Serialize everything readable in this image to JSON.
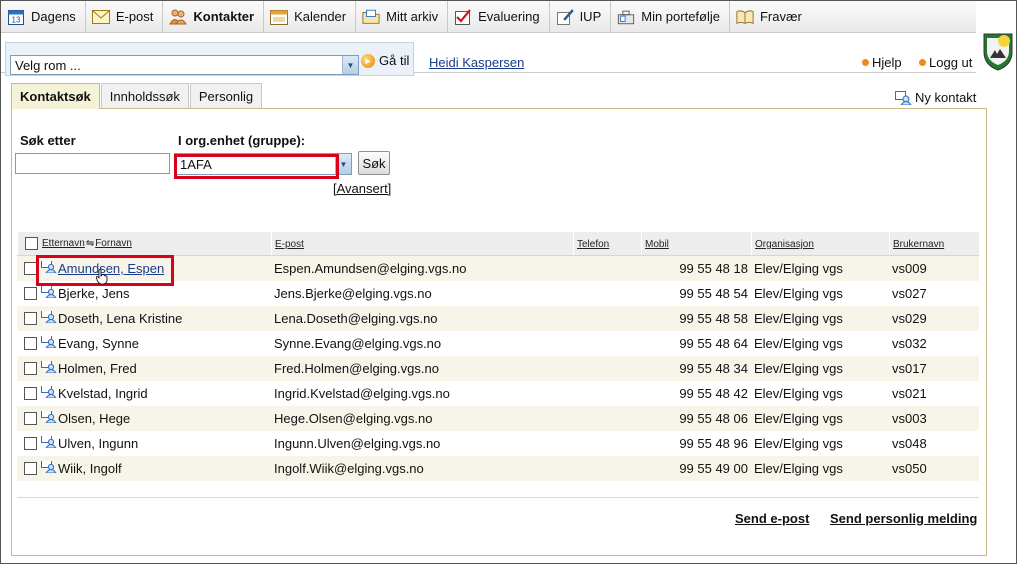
{
  "nav": {
    "items": [
      {
        "label": "Dagens",
        "icon": "calendar-day-icon",
        "active": false
      },
      {
        "label": "E-post",
        "icon": "envelope-icon",
        "active": false
      },
      {
        "label": "Kontakter",
        "icon": "contacts-icon",
        "active": true
      },
      {
        "label": "Kalender",
        "icon": "calendar-icon",
        "active": false
      },
      {
        "label": "Mitt arkiv",
        "icon": "folder-icon",
        "active": false
      },
      {
        "label": "Evaluering",
        "icon": "checkmark-icon",
        "active": false
      },
      {
        "label": "IUP",
        "icon": "edit-icon",
        "active": false
      },
      {
        "label": "Min portefølje",
        "icon": "portfolio-icon",
        "active": false
      },
      {
        "label": "Fravær",
        "icon": "book-icon",
        "active": false
      }
    ]
  },
  "toolbar": {
    "room_select": "Velg rom ...",
    "goto_label": "Gå til",
    "user_name": "Heidi Kaspersen",
    "help_label": "Hjelp",
    "logout_label": "Logg ut"
  },
  "tabs": [
    {
      "label": "Kontaktsøk",
      "active": true
    },
    {
      "label": "Innholdssøk",
      "active": false
    },
    {
      "label": "Personlig",
      "active": false
    }
  ],
  "new_contact_label": "Ny kontakt",
  "search": {
    "search_label": "Søk etter",
    "search_value": "",
    "org_label": "I org.enhet (gruppe):",
    "org_value": "1AFA",
    "search_button": "Søk",
    "advanced_link": "[Avansert]"
  },
  "table": {
    "headers": {
      "surname": "Etternavn",
      "firstname": "Fornavn",
      "email": "E-post",
      "phone": "Telefon",
      "mobile": "Mobil",
      "org": "Organisasjon",
      "username": "Brukernavn"
    },
    "rows": [
      {
        "name": "Amundsen, Espen",
        "email": "Espen.Amundsen@elging.vgs.no",
        "phone": "",
        "mobile": "99 55 48 18",
        "org": "Elev/Elging vgs",
        "user": "vs009",
        "link": true
      },
      {
        "name": "Bjerke, Jens",
        "email": "Jens.Bjerke@elging.vgs.no",
        "phone": "",
        "mobile": "99 55 48 54",
        "org": "Elev/Elging vgs",
        "user": "vs027",
        "link": false
      },
      {
        "name": "Doseth, Lena Kristine",
        "email": "Lena.Doseth@elging.vgs.no",
        "phone": "",
        "mobile": "99 55 48 58",
        "org": "Elev/Elging vgs",
        "user": "vs029",
        "link": false
      },
      {
        "name": "Evang, Synne",
        "email": "Synne.Evang@elging.vgs.no",
        "phone": "",
        "mobile": "99 55 48 64",
        "org": "Elev/Elging vgs",
        "user": "vs032",
        "link": false
      },
      {
        "name": "Holmen, Fred",
        "email": "Fred.Holmen@elging.vgs.no",
        "phone": "",
        "mobile": "99 55 48 34",
        "org": "Elev/Elging vgs",
        "user": "vs017",
        "link": false
      },
      {
        "name": "Kvelstad, Ingrid",
        "email": "Ingrid.Kvelstad@elging.vgs.no",
        "phone": "",
        "mobile": "99 55 48 42",
        "org": "Elev/Elging vgs",
        "user": "vs021",
        "link": false
      },
      {
        "name": "Olsen, Hege",
        "email": "Hege.Olsen@elging.vgs.no",
        "phone": "",
        "mobile": "99 55 48 06",
        "org": "Elev/Elging vgs",
        "user": "vs003",
        "link": false
      },
      {
        "name": "Ulven, Ingunn",
        "email": "Ingunn.Ulven@elging.vgs.no",
        "phone": "",
        "mobile": "99 55 48 96",
        "org": "Elev/Elging vgs",
        "user": "vs048",
        "link": false
      },
      {
        "name": "Wiik, Ingolf",
        "email": "Ingolf.Wiik@elging.vgs.no",
        "phone": "",
        "mobile": "99 55 49 00",
        "org": "Elev/Elging vgs",
        "user": "vs050",
        "link": false
      }
    ]
  },
  "footer": {
    "send_email": "Send e-post",
    "send_message": "Send personlig melding"
  },
  "colors": {
    "highlight": "#d9001b",
    "link": "#1a3c8b",
    "row_alt": "#f7f5e9",
    "accent": "#f08a1a"
  }
}
